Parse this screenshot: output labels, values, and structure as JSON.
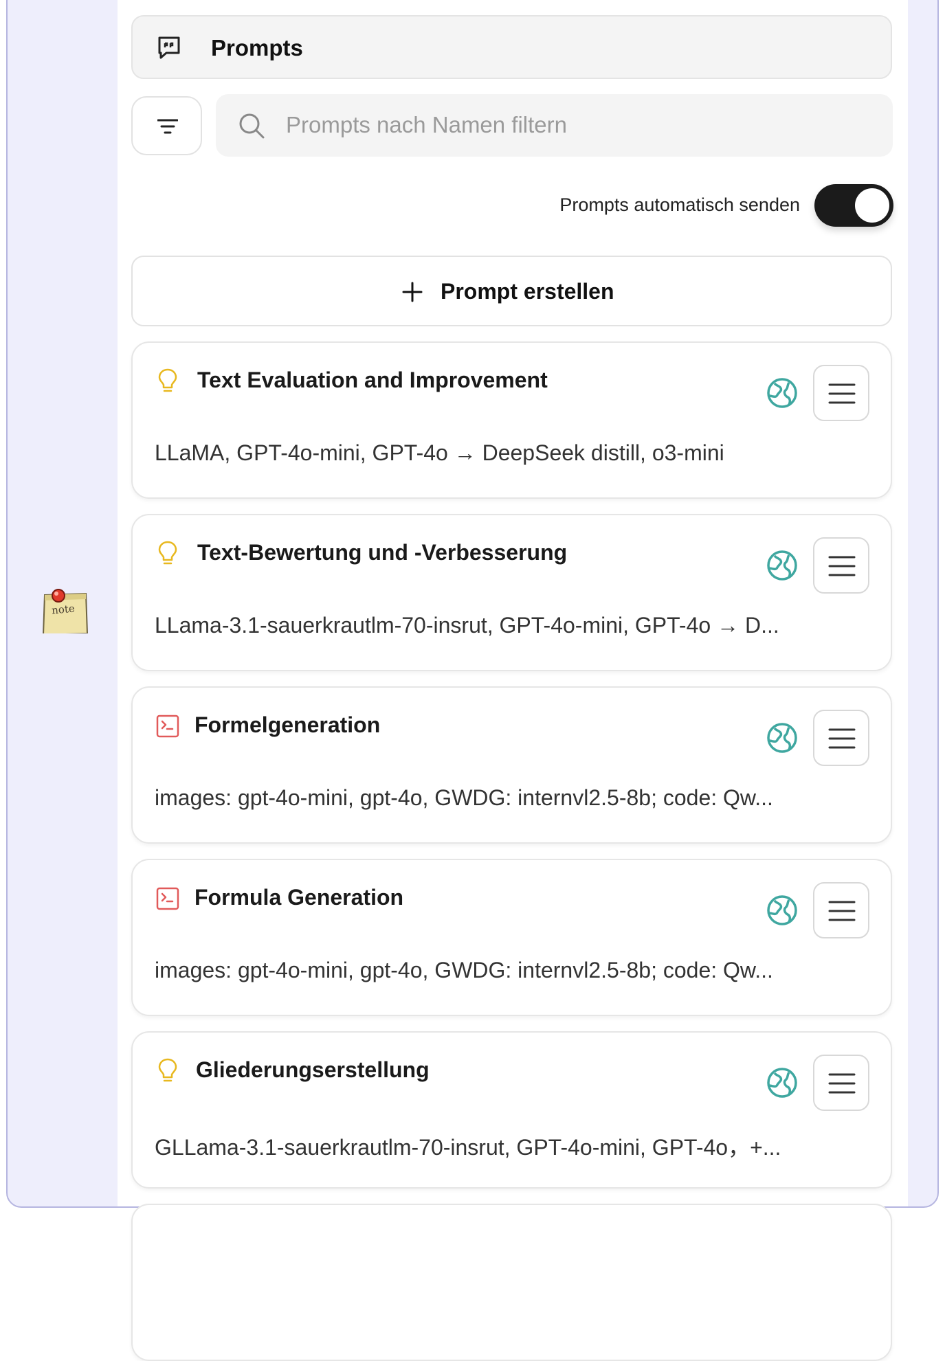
{
  "header": {
    "title": "Prompts",
    "icon": "speech-bubble-quote-icon"
  },
  "search": {
    "placeholder": "Prompts nach Namen filtern",
    "value": ""
  },
  "auto_send": {
    "label": "Prompts automatisch senden",
    "enabled": true
  },
  "create_button": {
    "label": "Prompt erstellen"
  },
  "desktop_note": {
    "label": "note"
  },
  "colors": {
    "background": "#eeeefc",
    "toggle_on": "#1b1b1b",
    "globe": "#3fa7a0",
    "bulb": "#e8b81f",
    "terminal": "#e15a5a"
  },
  "prompts": [
    {
      "title": "Text Evaluation and Improvement",
      "description": "LLaMA, GPT-4o-mini, GPT-4o → DeepSeek distill, o3-mini",
      "icon": "lightbulb-icon"
    },
    {
      "title": "Text-Bewertung und -Verbesserung",
      "description": "LLama-3.1-sauerkrautlm-70-insrut, GPT-4o-mini, GPT-4o → D...",
      "icon": "lightbulb-icon"
    },
    {
      "title": "Formelgeneration",
      "description": "images: gpt-4o-mini, gpt-4o, GWDG: internvl2.5-8b; code: Qw...",
      "icon": "terminal-icon"
    },
    {
      "title": "Formula Generation",
      "description": "images: gpt-4o-mini, gpt-4o, GWDG: internvl2.5-8b; code: Qw...",
      "icon": "terminal-icon"
    },
    {
      "title": "Gliederungserstellung",
      "description": "GLLama-3.1-sauerkrautlm-70-insrut, GPT-4o-mini, GPT-4o，+...",
      "icon": "lightbulb-icon"
    }
  ]
}
